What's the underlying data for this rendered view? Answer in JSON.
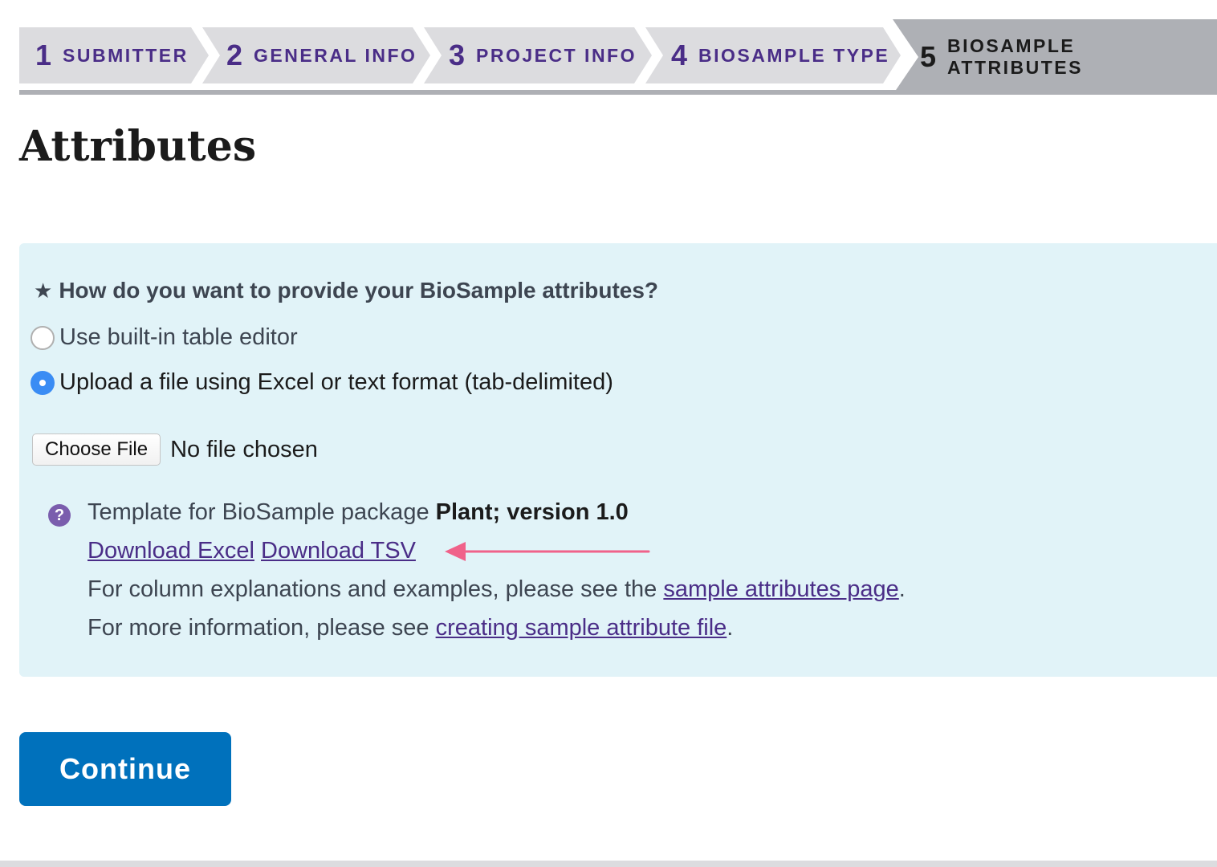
{
  "steps": [
    {
      "num": "1",
      "label": "SUBMITTER"
    },
    {
      "num": "2",
      "label": "GENERAL INFO"
    },
    {
      "num": "3",
      "label": "PROJECT INFO"
    },
    {
      "num": "4",
      "label": "BIOSAMPLE TYPE"
    },
    {
      "num": "5",
      "label": "BIOSAMPLE ATTRIBUTES"
    }
  ],
  "active_step": "5",
  "page_title": "Attributes",
  "panel": {
    "question_marker": "★",
    "question": "How do you want to provide your BioSample attributes?",
    "options": [
      {
        "label": "Use built-in table editor",
        "selected": false
      },
      {
        "label": "Upload a file using Excel or text format (tab-delimited)",
        "selected": true
      }
    ],
    "file_input": {
      "button_label": "Choose File",
      "status": "No file chosen"
    },
    "info": {
      "icon": "question-circle-icon",
      "template_prefix": "Template for BioSample package ",
      "template_package": "Plant; version 1.0",
      "download_excel": "Download Excel",
      "download_tsv": "Download TSV",
      "columns_prefix": "For column explanations and examples, please see the ",
      "columns_link": "sample attributes page",
      "columns_suffix": ".",
      "more_prefix": "For more information, please see ",
      "more_link": "creating sample attribute file",
      "more_suffix": "."
    }
  },
  "continue_label": "Continue",
  "colors": {
    "accent_purple": "#4a2d87",
    "panel_bg": "#e1f3f8",
    "primary_button": "#0071bc",
    "annotation_arrow": "#f0628a",
    "radio_selected": "#3a8cf4"
  }
}
